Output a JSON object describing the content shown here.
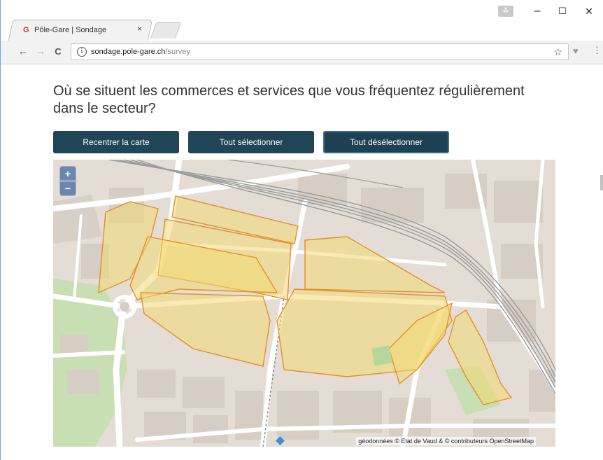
{
  "browser": {
    "tab_title": "Pôle-Gare | Sondage",
    "tab_close": "×",
    "favicon_glyph": "G",
    "user_icon_glyph": "≛",
    "win_minimize": "–",
    "win_maximize": "☐",
    "win_close": "✕",
    "back": "←",
    "forward": "→",
    "reload": "C",
    "info_glyph": "i",
    "url_host": "sondage.pole-gare.ch",
    "url_path": "/survey",
    "star": "☆",
    "shield": "♥",
    "menu": "⋮"
  },
  "survey": {
    "question": "Où se situent les commerces et services que vous fréquentez régulièrement dans le secteur?",
    "buttons": {
      "recenter": "Recentrer la carte",
      "select_all": "Tout sélectionner",
      "deselect_all": "Tout désélectionner"
    }
  },
  "map": {
    "zoom_in": "+",
    "zoom_out": "−",
    "attribution": "géodonnées © Etat de Vaud & © contributeurs OpenStreetMap",
    "colors": {
      "background": "#e3ddd5",
      "roads": "#ffffff",
      "buildings": "#d6cec4",
      "park": "#c7dfb2",
      "rail": "#9a9a9a",
      "selection_fill": "#f2d873",
      "selection_stroke": "#e58f27"
    }
  }
}
